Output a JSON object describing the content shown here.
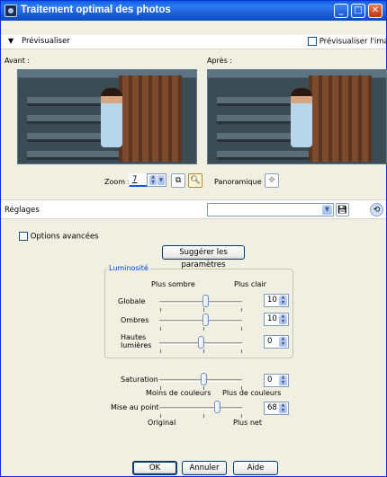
{
  "window": {
    "title": "Traitement optimal des photos"
  },
  "preview": {
    "toggle_label": "Prévisualiser",
    "preview_image_label": "Prévisualiser l'image",
    "before_label": "Avant :",
    "after_label": "Après :",
    "zoom_label": "Zoom :",
    "zoom_value": "7",
    "pan_label": "Panoramique :"
  },
  "settings": {
    "label": "Réglages",
    "preset_value": ""
  },
  "advanced": {
    "label": "Options avancées"
  },
  "suggest_button": "Suggérer les paramètres",
  "luminosity": {
    "group_label": "Luminosité",
    "darker_label": "Plus sombre",
    "lighter_label": "Plus clair",
    "sliders": [
      {
        "label": "Globale",
        "value": "10"
      },
      {
        "label": "Ombres",
        "value": "10"
      },
      {
        "label": "Hautes lumières",
        "value": "0"
      }
    ]
  },
  "saturation": {
    "label": "Saturation",
    "value": "0",
    "less_label": "Moins de couleurs",
    "more_label": "Plus de couleurs"
  },
  "focus": {
    "label": "Mise au point",
    "value": "68",
    "original_label": "Original",
    "sharper_label": "Plus net"
  },
  "buttons": {
    "ok": "OK",
    "cancel": "Annuler",
    "help": "Aide"
  }
}
